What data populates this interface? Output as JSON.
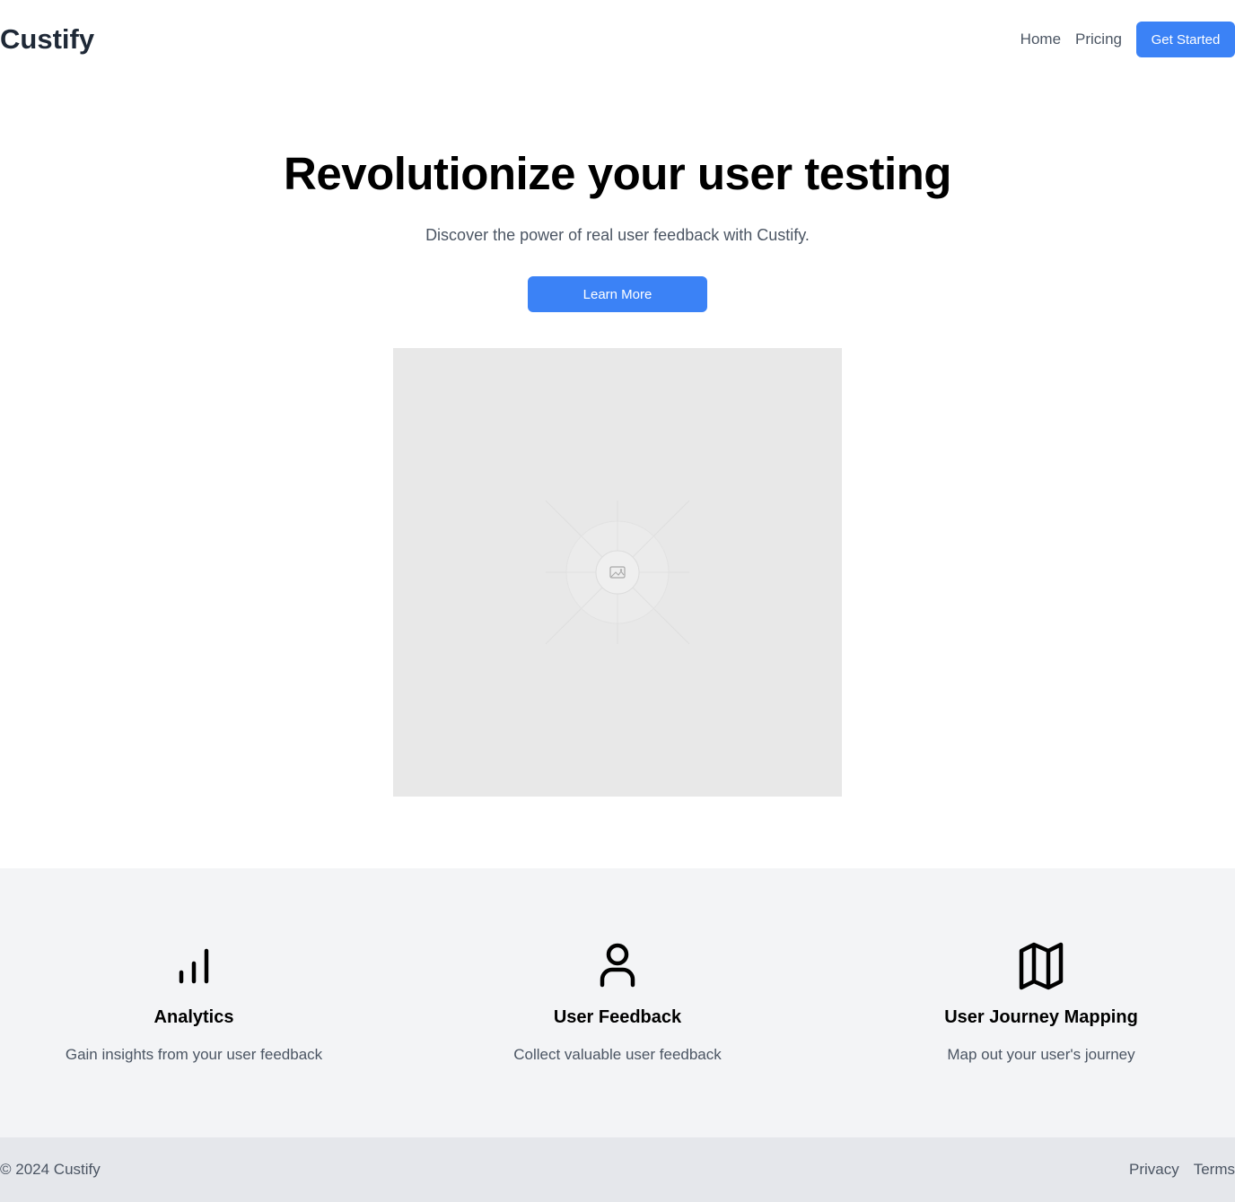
{
  "header": {
    "logo": "Custify",
    "nav": {
      "home": "Home",
      "pricing": "Pricing"
    },
    "cta": "Get Started"
  },
  "hero": {
    "title": "Revolutionize your user testing",
    "subtitle": "Discover the power of real user feedback with Custify.",
    "button": "Learn More",
    "image_icon": "image-placeholder-icon"
  },
  "features": [
    {
      "icon": "bar-chart-icon",
      "title": "Analytics",
      "description": "Gain insights from your user feedback"
    },
    {
      "icon": "user-icon",
      "title": "User Feedback",
      "description": "Collect valuable user feedback"
    },
    {
      "icon": "map-icon",
      "title": "User Journey Mapping",
      "description": "Map out your user's journey"
    }
  ],
  "footer": {
    "copyright": "© 2024 Custify",
    "links": {
      "privacy": "Privacy",
      "terms": "Terms"
    }
  },
  "colors": {
    "accent": "#3b82f6",
    "features_bg": "#f3f4f6",
    "footer_bg": "#e5e7eb",
    "placeholder_bg": "#e8e8e8"
  }
}
